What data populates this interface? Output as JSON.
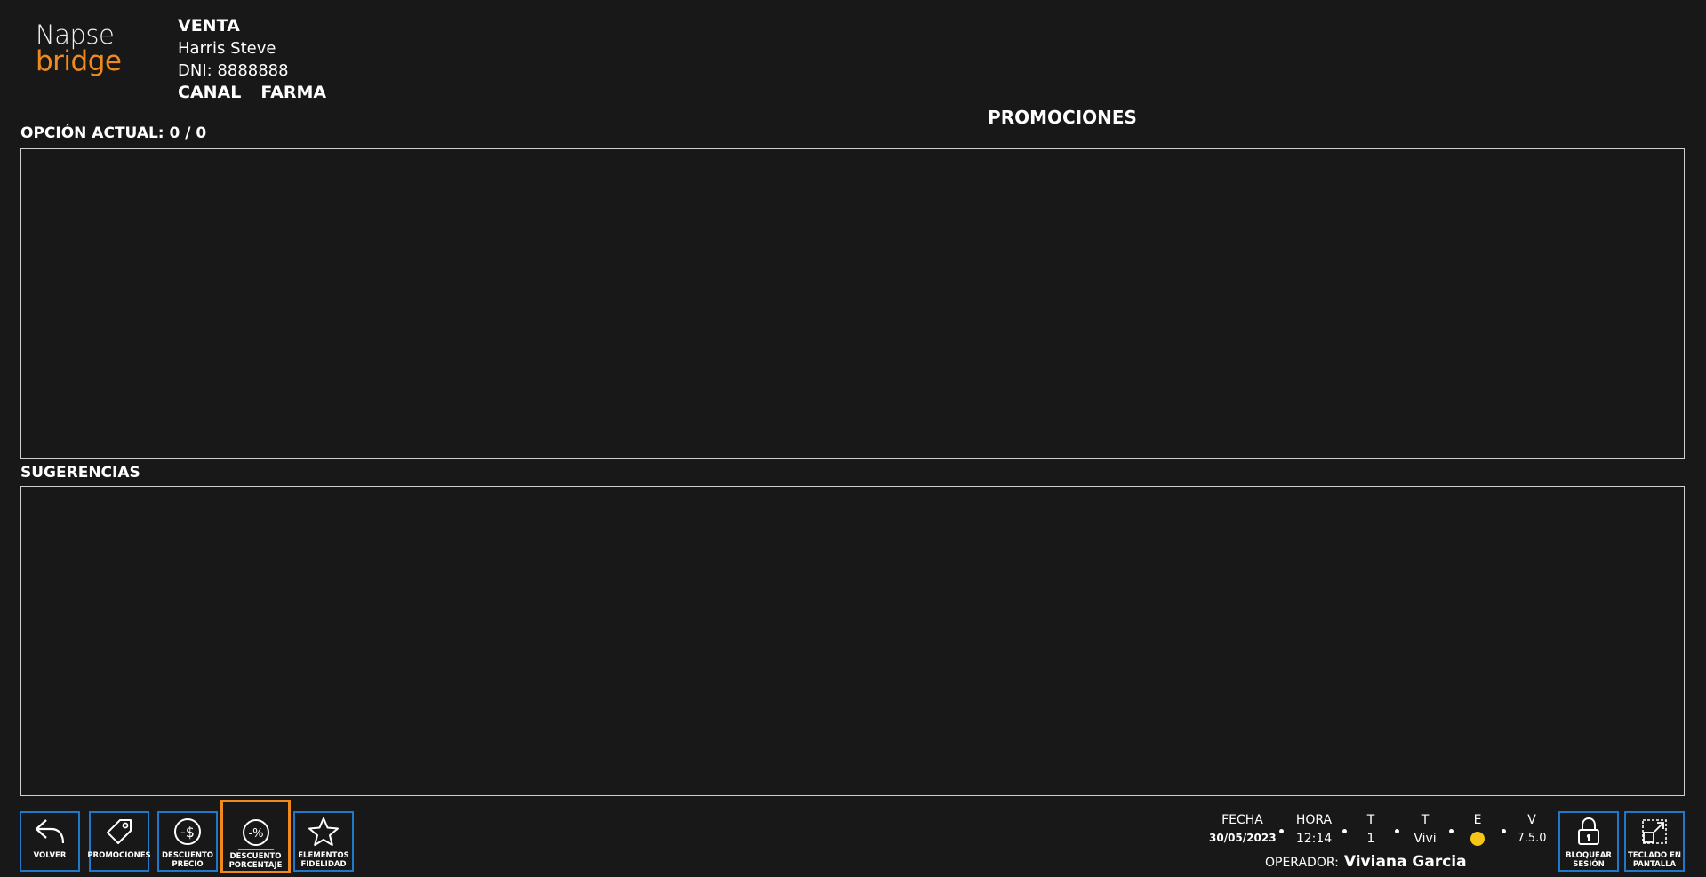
{
  "logo": {
    "line1": "Napse",
    "line2": "bridge"
  },
  "header": {
    "mode": "VENTA",
    "customer_name": "Harris Steve",
    "customer_id": "DNI: 8888888",
    "canal_label": "CANAL",
    "canal_value": "FARMA"
  },
  "screen_title": "PROMOCIONES",
  "current_option": {
    "label": "OPCIÓN ACTUAL: 0 / 0"
  },
  "suggestions": {
    "label": "SUGERENCIAS"
  },
  "toolbar": {
    "buttons": [
      {
        "label1": "VOLVER",
        "label2": "",
        "icon": "undo-arrow-icon"
      },
      {
        "label1": "PROMOCIONES",
        "label2": "",
        "icon": "tag-icon"
      },
      {
        "label1": "DESCUENTO",
        "label2": "PRECIO",
        "icon": "minus-dollar-icon"
      },
      {
        "label1": "DESCUENTO",
        "label2": "PORCENTAJE",
        "icon": "minus-percent-icon"
      },
      {
        "label1": "ELEMENTOS",
        "label2": "FIDELIDAD",
        "icon": "star-icon"
      }
    ],
    "active_color": "#f08a1e",
    "border_color": "#1f78c8"
  },
  "status": {
    "fecha_label": "FECHA",
    "fecha_value": "30/05/2023",
    "hora_label": "HORA",
    "hora_value": "12:14",
    "t1_label": "T",
    "t1_value": "1",
    "t2_label": "T",
    "t2_value": "Vivi",
    "e_label": "E",
    "e_color": "#f5c518",
    "v_label": "V",
    "v_value": "7.5.0",
    "operator_label": "OPERADOR:",
    "operator_name": "Viviana Garcia"
  },
  "right_buttons": [
    {
      "label1": "BLOQUEAR",
      "label2": "SESIÓN",
      "icon": "lock-icon"
    },
    {
      "label1": "TECLADO EN",
      "label2": "PANTALLA",
      "icon": "keyboard-expand-icon"
    }
  ]
}
